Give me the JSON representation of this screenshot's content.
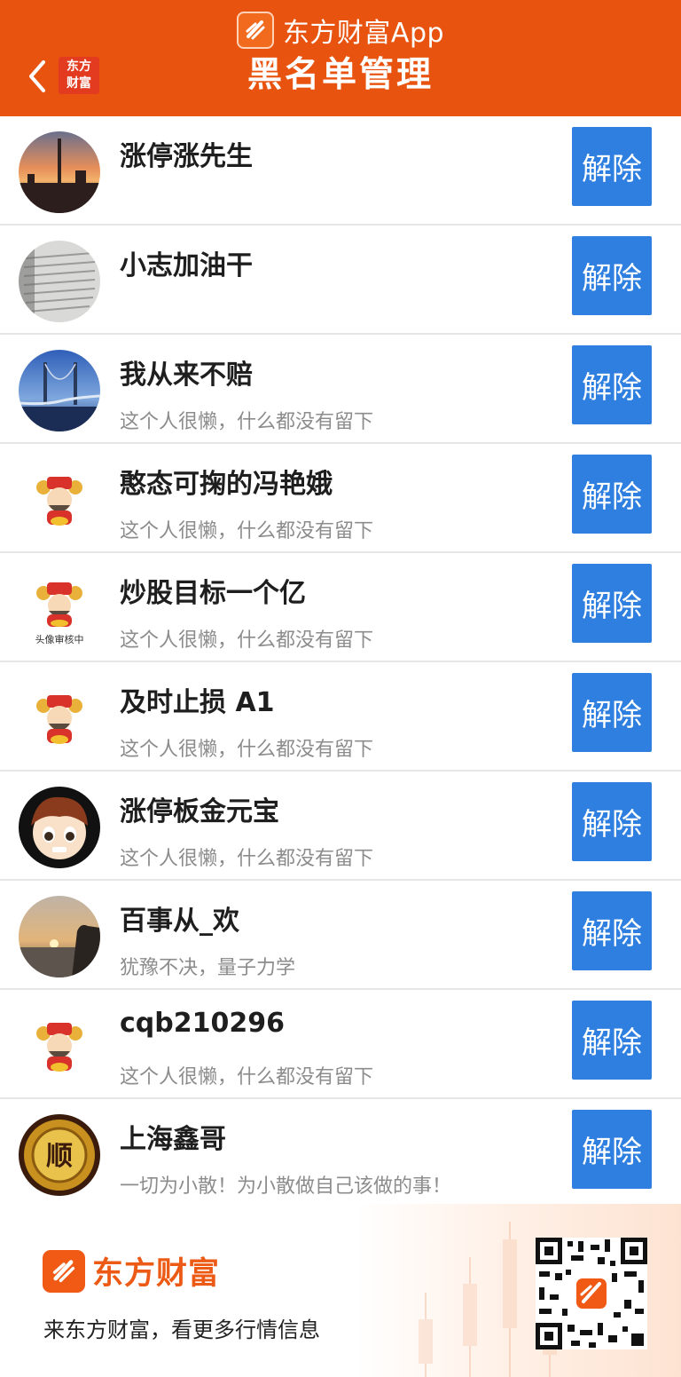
{
  "header": {
    "brand_name": "东方财富App",
    "mini_logo_line1": "东方",
    "mini_logo_line2": "财富",
    "title": "黑名单管理",
    "bg_color": "#e8540f"
  },
  "button_color": "#2e7fe0",
  "blacklist": [
    {
      "name": "涨停涨先生",
      "signature": "",
      "avatar": "sunset-city",
      "button": "解除"
    },
    {
      "name": "小志加油干",
      "signature": "",
      "avatar": "book-page",
      "button": "解除"
    },
    {
      "name": "我从来不赔",
      "signature": "这个人很懒，什么都没有留下",
      "avatar": "bridge",
      "button": "解除"
    },
    {
      "name": "憨态可掬的冯艳娥",
      "signature": "这个人很懒，什么都没有留下",
      "avatar": "fortune-god",
      "button": "解除"
    },
    {
      "name": "炒股目标一个亿",
      "signature": "这个人很懒，什么都没有留下",
      "avatar": "fortune-god-review",
      "avatar_caption": "头像审核中",
      "button": "解除"
    },
    {
      "name": "及时止损 A1",
      "signature": "这个人很懒，什么都没有留下",
      "avatar": "fortune-god",
      "button": "解除"
    },
    {
      "name": "涨停板金元宝",
      "signature": "这个人很懒，什么都没有留下",
      "avatar": "cartoon-boy",
      "button": "解除"
    },
    {
      "name": "百事从_欢",
      "signature": "犹豫不决，量子力学",
      "avatar": "sunset-hand",
      "button": "解除"
    },
    {
      "name": "cqb210296",
      "signature": "这个人很懒，什么都没有留下",
      "avatar": "fortune-god",
      "button": "解除"
    },
    {
      "name": "上海鑫哥",
      "signature": "一切为小散！为小散做自己该做的事！",
      "avatar": "gold-shun",
      "avatar_caption": "顺",
      "button": "解除"
    }
  ],
  "footer": {
    "logo_text": "东方财富",
    "slogan": "来东方财富，看更多行情信息",
    "qr": "qr-code"
  }
}
